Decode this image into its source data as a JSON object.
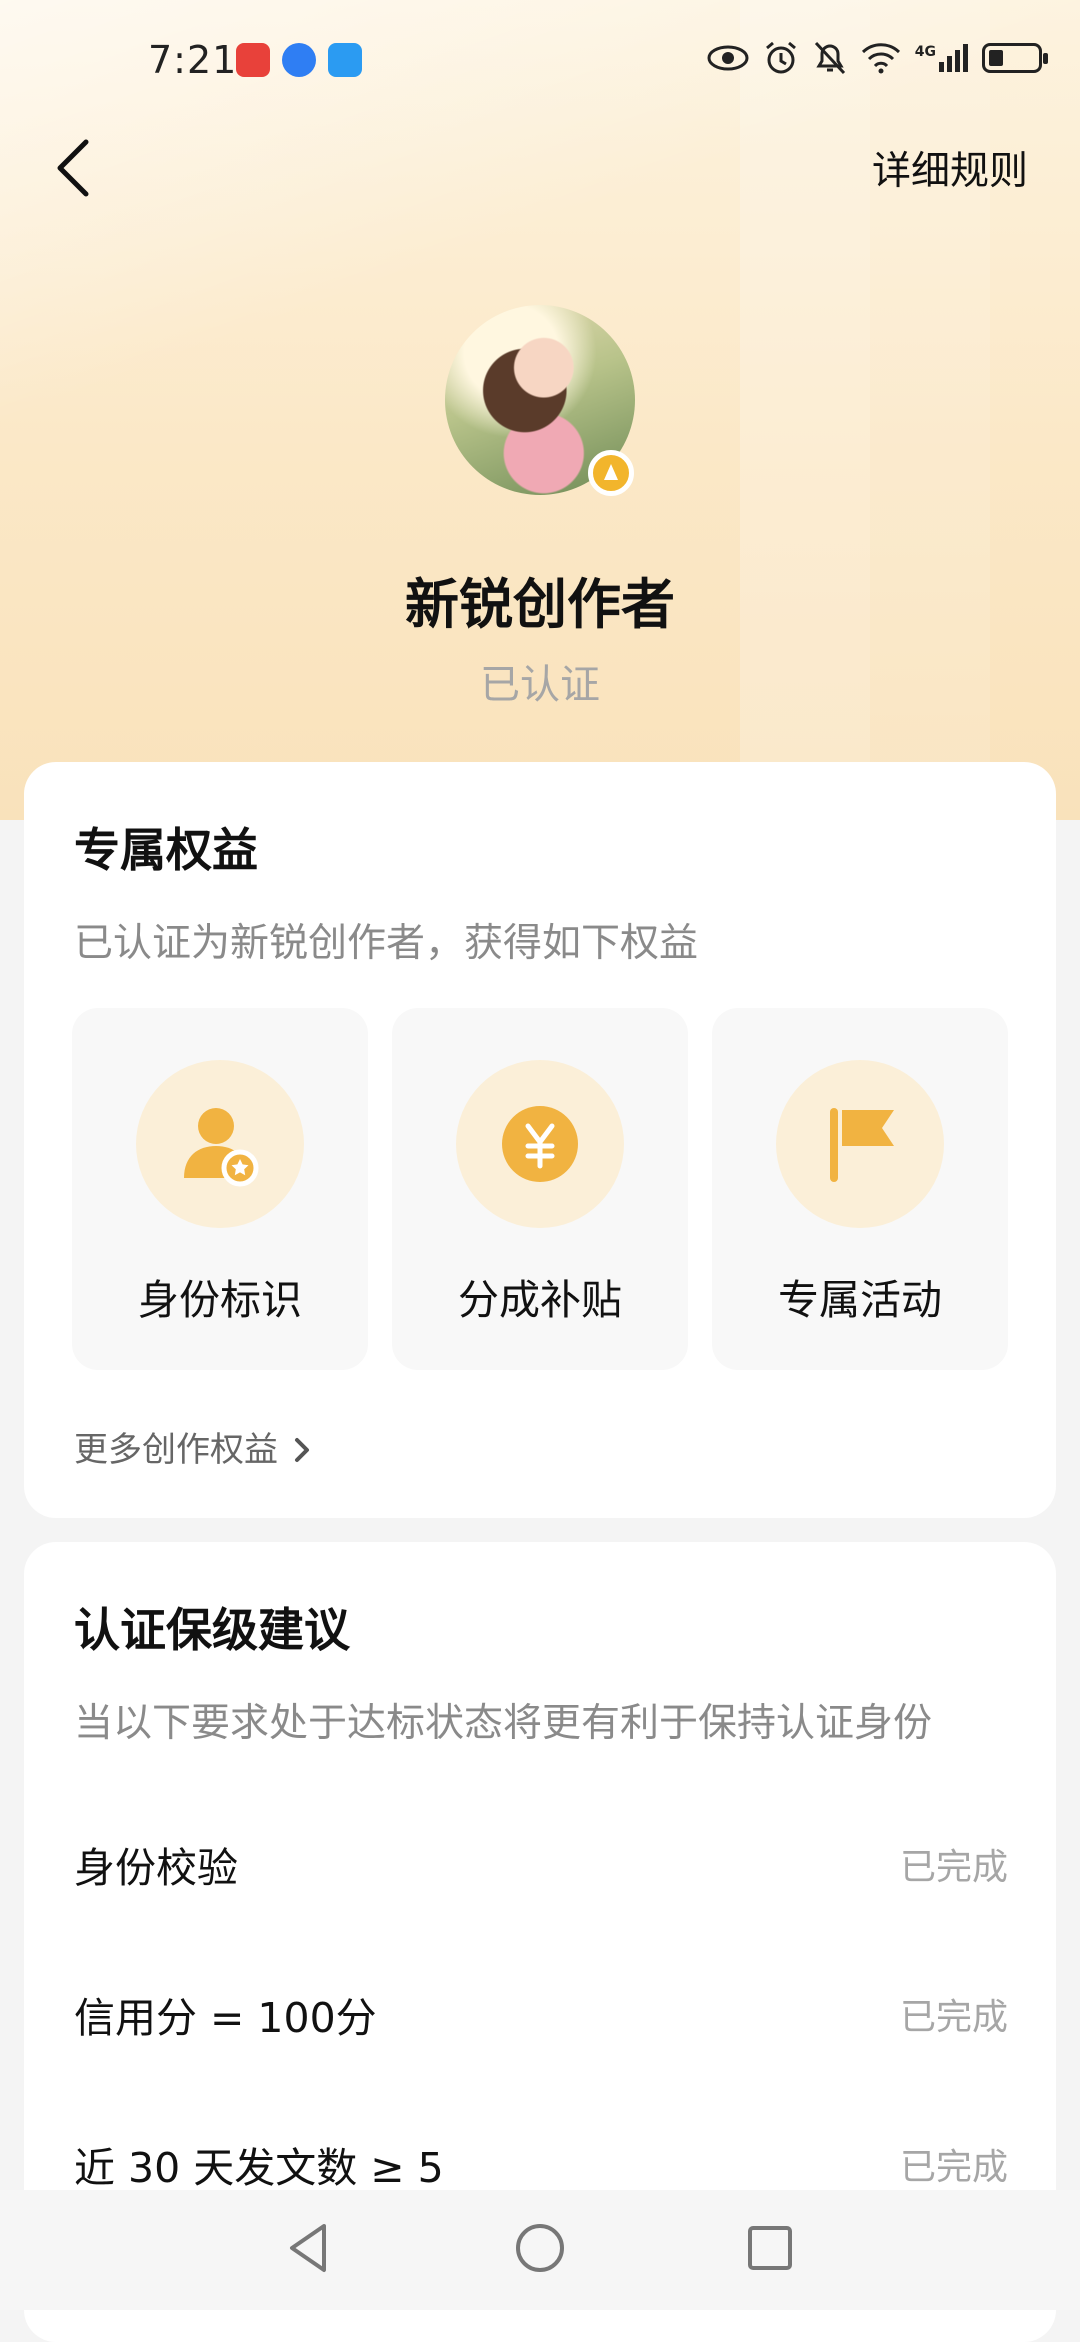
{
  "status_bar": {
    "time": "7:21",
    "network_label": "4G",
    "icons": [
      "huawei-appgallery-icon",
      "browser-icon",
      "message-icon",
      "eye-icon",
      "alarm-icon",
      "mute-icon",
      "wifi-icon",
      "signal-icon",
      "battery-icon"
    ]
  },
  "header": {
    "back_icon": "chevron-left-icon",
    "rules_label": "详细规则"
  },
  "profile": {
    "title": "新锐创作者",
    "status": "已认证"
  },
  "benefits_card": {
    "title": "专属权益",
    "subtitle": "已认证为新锐创作者，获得如下权益",
    "items": [
      {
        "label": "身份标识",
        "icon": "user-badge-icon"
      },
      {
        "label": "分成补贴",
        "icon": "yuan-coin-icon"
      },
      {
        "label": "专属活动",
        "icon": "flag-icon"
      }
    ],
    "more_label": "更多创作权益",
    "more_icon": "chevron-right-icon"
  },
  "requirements_card": {
    "title": "认证保级建议",
    "subtitle": "当以下要求处于达标状态将更有利于保持认证身份",
    "rows": [
      {
        "label": "身份校验",
        "state": "已完成"
      },
      {
        "label": "信用分 = 100分",
        "state": "已完成"
      },
      {
        "label": "近 30 天发文数 ≥ 5",
        "state": "已完成"
      }
    ]
  },
  "nav_bar": {
    "icons": [
      "back-triangle-icon",
      "home-circle-icon",
      "recents-square-icon"
    ]
  },
  "colors": {
    "accent_gold": "#f2b52c",
    "hero_bg": "#fbe8c7",
    "muted_text": "#a6a6a6"
  }
}
